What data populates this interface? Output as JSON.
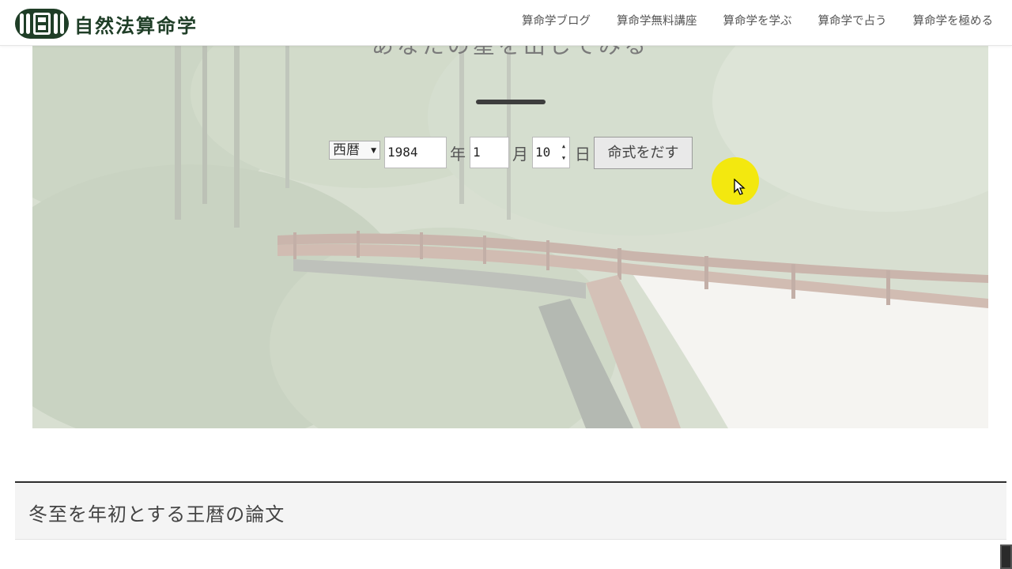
{
  "site": {
    "logo_text": "自然法算命学"
  },
  "nav": {
    "items": [
      {
        "label": "算命学ブログ"
      },
      {
        "label": "算命学無料講座"
      },
      {
        "label": "算命学を学ぶ"
      },
      {
        "label": "算命学で占う"
      },
      {
        "label": "算命学を極める"
      }
    ]
  },
  "hero": {
    "heading": "あなたの星を出してみる",
    "form": {
      "era_selected": "西暦",
      "year_value": "1984",
      "year_unit": "年",
      "month_value": "1",
      "month_unit": "月",
      "day_value": "10",
      "day_unit": "日",
      "submit_label": "命式をだす"
    }
  },
  "article": {
    "title": "冬至を年初とする王暦の論文"
  },
  "colors": {
    "logo_green": "#1f3e27",
    "cursor_highlight": "#f5e800",
    "nav_text": "#555555"
  }
}
